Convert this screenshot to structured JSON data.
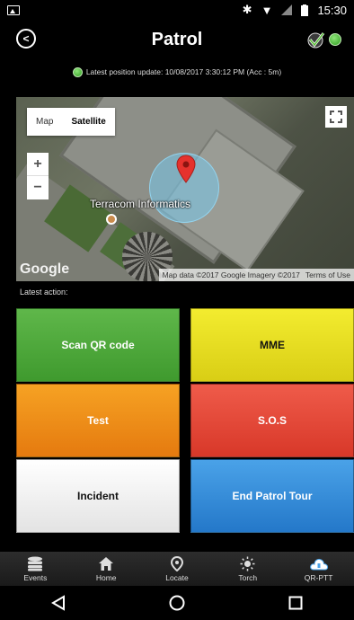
{
  "status_bar": {
    "time": "15:30"
  },
  "title_bar": {
    "title": "Patrol"
  },
  "position": {
    "text": "Latest position update: 10/08/2017 3:30:12 PM (Acc : 5m)"
  },
  "map": {
    "type_options": [
      "Map",
      "Satellite"
    ],
    "selected_type": "Satellite",
    "zoom_in": "+",
    "zoom_out": "−",
    "place_label": "Terracom Informatics",
    "logo": "Google",
    "attribution": "Map data ©2017 Google Imagery ©2017",
    "terms": "Terms of Use"
  },
  "latest_action_label": "Latest action:",
  "actions": {
    "scan": "Scan QR code",
    "mme": "MME",
    "test": "Test",
    "sos": "S.O.S",
    "incident": "Incident",
    "end": "End Patrol Tour"
  },
  "nav": [
    {
      "label": "Events",
      "icon": "database-icon"
    },
    {
      "label": "Home",
      "icon": "home-icon"
    },
    {
      "label": "Locate",
      "icon": "location-pin-icon"
    },
    {
      "label": "Torch",
      "icon": "sun-icon"
    },
    {
      "label": "QR-PTT",
      "icon": "cloud-icon"
    }
  ],
  "colors": {
    "scan": "#4CAF3A",
    "mme": "#E8E020",
    "test": "#F08C1A",
    "sos": "#E44A3A",
    "incident": "#F2F2F2",
    "end": "#3A8FDA",
    "status_green": "#3FBF2A"
  }
}
